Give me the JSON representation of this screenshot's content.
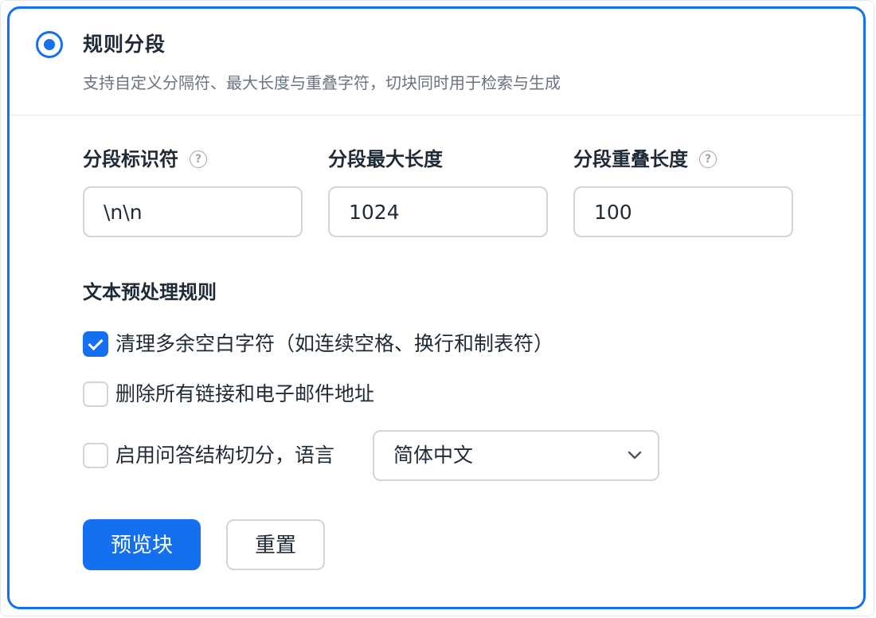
{
  "header": {
    "title": "规则分段",
    "description": "支持自定义分隔符、最大长度与重叠字符，切块同时用于检索与生成"
  },
  "fields": [
    {
      "label": "分段标识符",
      "value": "\\n\\n",
      "help_icon": "question-circle-icon"
    },
    {
      "label": "分段最大长度",
      "value": "1024"
    },
    {
      "label": "分段重叠长度",
      "value": "100",
      "help_icon": "question-circle-icon"
    }
  ],
  "preprocessing": {
    "title": "文本预处理规则",
    "options": [
      {
        "label": "清理多余空白字符（如连续空格、换行和制表符）",
        "checked": true
      },
      {
        "label": "删除所有链接和电子邮件地址",
        "checked": false
      },
      {
        "label": "启用问答结构切分，语言",
        "checked": false
      }
    ],
    "language_select": {
      "value": "简体中文",
      "icon": "chevron-down-icon"
    }
  },
  "buttons": {
    "preview": "预览块",
    "reset": "重置"
  },
  "colors": {
    "accent": "#1570ef",
    "border": "#d0d5dd",
    "text": "#1f2a37",
    "muted": "#6b7280"
  }
}
